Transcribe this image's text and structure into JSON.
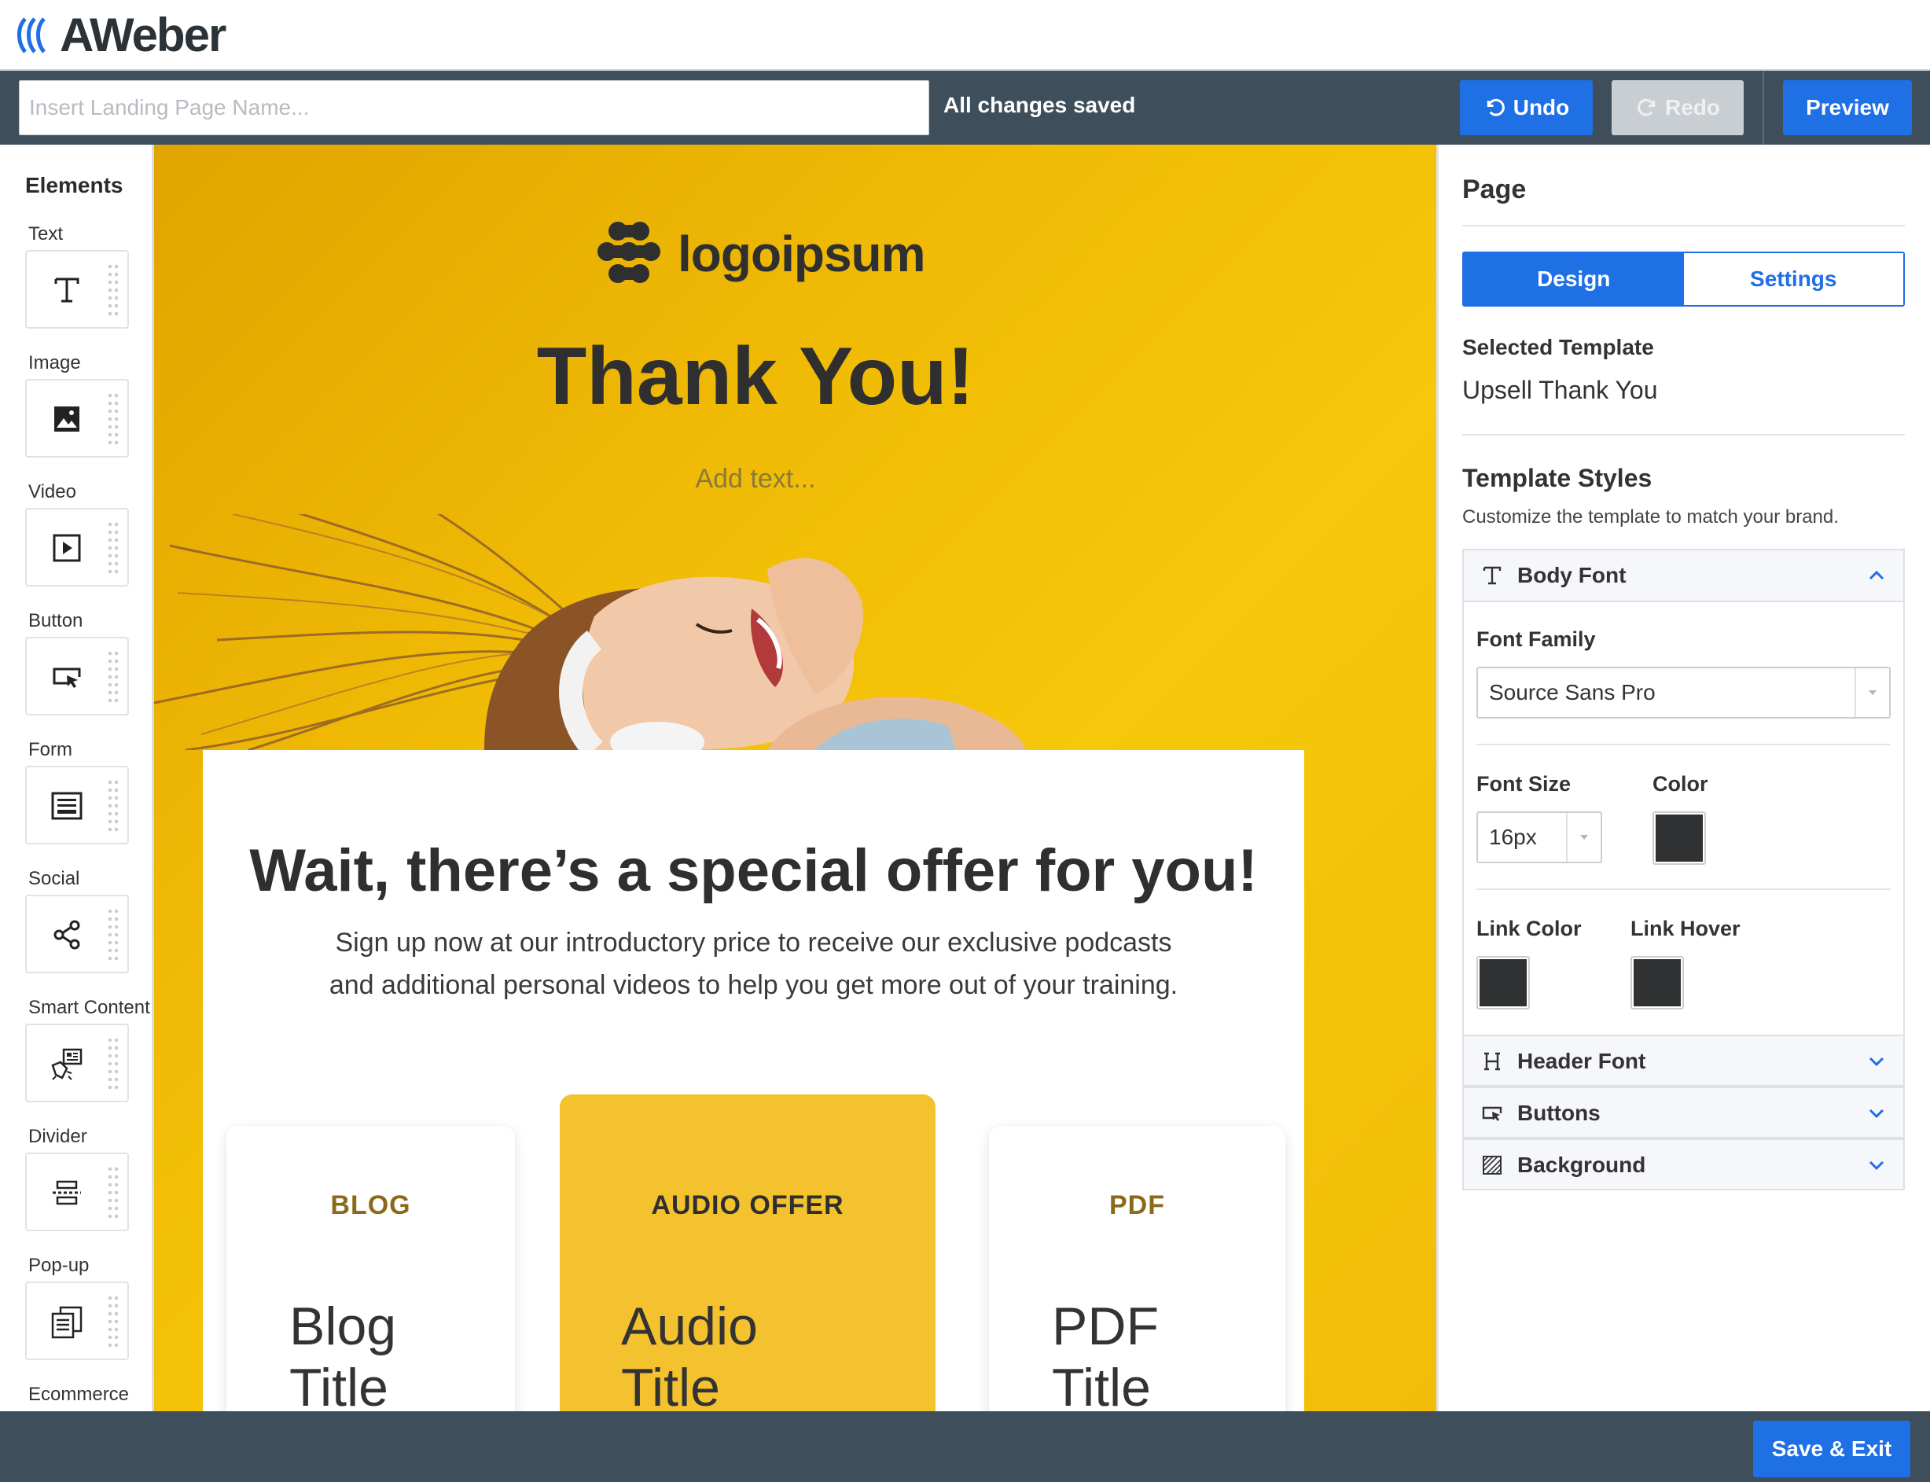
{
  "brand": {
    "name": "AWeber"
  },
  "toolbar": {
    "name_placeholder": "Insert Landing Page Name...",
    "name_value": "",
    "status": "All changes saved",
    "undo_label": "Undo",
    "redo_label": "Redo",
    "preview_label": "Preview"
  },
  "elements": {
    "title": "Elements",
    "items": [
      {
        "label": "Text",
        "icon": "text-icon"
      },
      {
        "label": "Image",
        "icon": "image-icon"
      },
      {
        "label": "Video",
        "icon": "video-icon"
      },
      {
        "label": "Button",
        "icon": "button-icon"
      },
      {
        "label": "Form",
        "icon": "form-icon"
      },
      {
        "label": "Social",
        "icon": "share-icon"
      },
      {
        "label": "Smart Content",
        "icon": "smart-content-icon"
      },
      {
        "label": "Divider",
        "icon": "divider-icon"
      },
      {
        "label": "Pop-up",
        "icon": "popup-icon"
      },
      {
        "label": "Ecommerce",
        "icon": "ecommerce-icon"
      }
    ]
  },
  "canvas": {
    "logo_text": "logoipsum",
    "heading": "Thank You!",
    "add_text": "Add text...",
    "offer_heading": "Wait, there’s a special offer for you!",
    "offer_line1": "Sign up now at our introductory price to receive our exclusive podcasts",
    "offer_line2": "and additional personal videos to help you get more out of your training.",
    "cards": [
      {
        "tag": "BLOG",
        "title1": "Blog",
        "title2": "Title"
      },
      {
        "tag": "AUDIO OFFER",
        "title1": "Audio",
        "title2": "Title"
      },
      {
        "tag": "PDF",
        "title1": "PDF",
        "title2": "Title"
      }
    ]
  },
  "panel": {
    "title": "Page",
    "tabs": {
      "design": "Design",
      "settings": "Settings"
    },
    "selected_template_label": "Selected Template",
    "selected_template_value": "Upsell Thank You",
    "styles_heading": "Template Styles",
    "styles_desc": "Customize the template to match your brand.",
    "body_font": {
      "label": "Body Font",
      "font_family_label": "Font Family",
      "font_family_value": "Source Sans Pro",
      "font_size_label": "Font Size",
      "font_size_value": "16px",
      "color_label": "Color",
      "link_color_label": "Link Color",
      "link_hover_label": "Link Hover",
      "color_value": "#2f3133"
    },
    "header_font_label": "Header Font",
    "buttons_label": "Buttons",
    "background_label": "Background"
  },
  "footer": {
    "save_exit_label": "Save & Exit"
  },
  "colors": {
    "accent": "#1f6fe5",
    "toolbar": "#3e4f5b",
    "canvas_bg": "#f2bd08",
    "card_tag": "#8a6a1a"
  }
}
